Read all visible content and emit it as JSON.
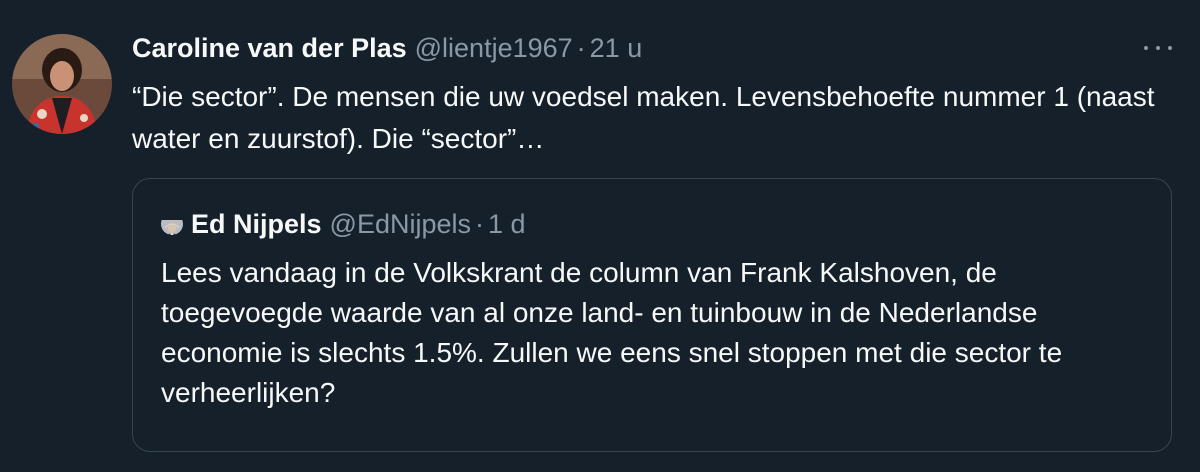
{
  "tweet": {
    "author_name": "Caroline van der Plas",
    "handle": "@lientje1967",
    "separator": "·",
    "time": "21 u",
    "text": "“Die sector”. De mensen die uw voedsel maken. Levensbehoefte nummer 1 (naast water en zuurstof). Die “sector”…",
    "more_icon": "more-horizontal-icon"
  },
  "quoted_tweet": {
    "author_name": "Ed Nijpels",
    "handle": "@EdNijpels",
    "separator": "·",
    "time": "1 d",
    "text": "Lees vandaag in de Volkskrant de column van Frank Kalshoven, de toegevoegde waarde van al onze land- en tuinbouw in de Nederlandse economie is slechts 1.5%. Zullen we eens snel stoppen met die sector te verheerlijken?"
  },
  "colors": {
    "background": "#15202b",
    "text_primary": "#f7f9f9",
    "text_secondary": "#8b98a5",
    "border": "#38444d"
  }
}
